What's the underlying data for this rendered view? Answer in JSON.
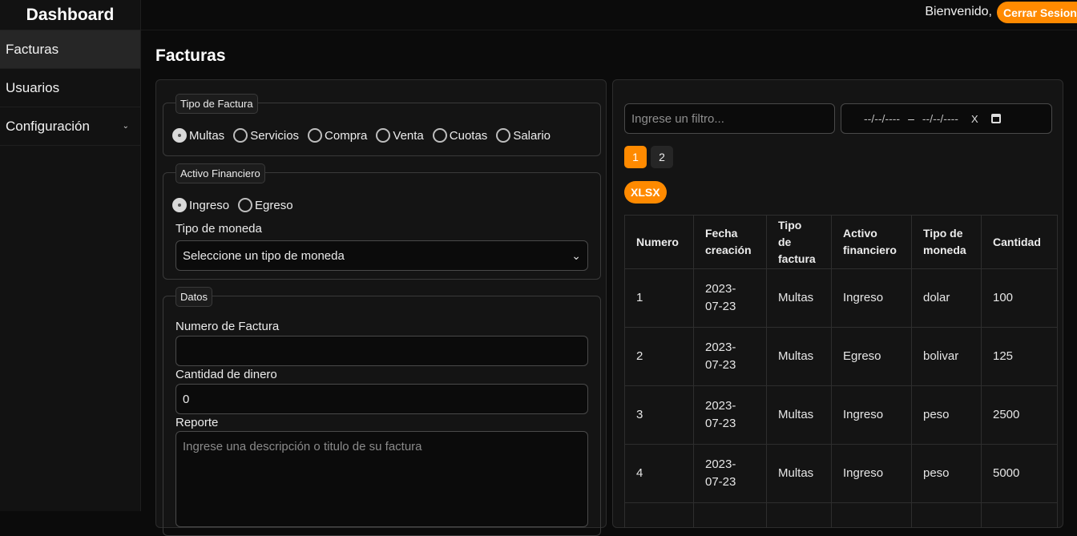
{
  "brand": "Dashboard",
  "sidebar": {
    "items": [
      {
        "label": "Facturas"
      },
      {
        "label": "Usuarios"
      },
      {
        "label": "Configuración"
      }
    ],
    "caret": "⌄"
  },
  "header": {
    "welcome": "Bienvenido,",
    "logout": "Cerrar Sesion"
  },
  "page_title": "Facturas",
  "form": {
    "tipo_factura": {
      "legend": "Tipo de Factura",
      "options": [
        "Multas",
        "Servicios",
        "Compra",
        "Venta",
        "Cuotas",
        "Salario"
      ],
      "selected": "Multas"
    },
    "activo": {
      "legend": "Activo Financiero",
      "options": [
        "Ingreso",
        "Egreso"
      ],
      "selected": "Ingreso",
      "moneda_label": "Tipo de moneda",
      "moneda_value": "Seleccione un tipo de moneda"
    },
    "datos": {
      "legend": "Datos",
      "numero_label": "Numero de Factura",
      "numero_value": "",
      "cantidad_label": "Cantidad de dinero",
      "cantidad_value": "0",
      "reporte_label": "Reporte",
      "reporte_placeholder": "Ingrese una descripción o titulo de su factura"
    }
  },
  "table_panel": {
    "filter_placeholder": "Ingrese un filtro...",
    "date_from": "--/--/----",
    "date_sep": "–",
    "date_to": "--/--/----",
    "date_clear": "X",
    "pages": [
      "1",
      "2"
    ],
    "active_page": "1",
    "export_label": "XLSX",
    "headers": [
      [
        "Numero"
      ],
      [
        "Fecha",
        "creación"
      ],
      [
        "Tipo",
        "de",
        "factura"
      ],
      [
        "Activo",
        "financiero"
      ],
      [
        "Tipo de",
        "moneda"
      ],
      [
        "Cantidad"
      ]
    ],
    "rows": [
      [
        [
          "1"
        ],
        [
          "2023-",
          "07-23"
        ],
        [
          "Multas"
        ],
        [
          "Ingreso"
        ],
        [
          "dolar"
        ],
        [
          "100"
        ]
      ],
      [
        [
          "2"
        ],
        [
          "2023-",
          "07-23"
        ],
        [
          "Multas"
        ],
        [
          "Egreso"
        ],
        [
          "bolivar"
        ],
        [
          "125"
        ]
      ],
      [
        [
          "3"
        ],
        [
          "2023-",
          "07-23"
        ],
        [
          "Multas"
        ],
        [
          "Ingreso"
        ],
        [
          "peso"
        ],
        [
          "2500"
        ]
      ],
      [
        [
          "4"
        ],
        [
          "2023-",
          "07-23"
        ],
        [
          "Multas"
        ],
        [
          "Ingreso"
        ],
        [
          "peso"
        ],
        [
          "5000"
        ]
      ]
    ]
  },
  "colors": {
    "accent": "#ff8a00",
    "background": "#0b0b0b",
    "panel": "#141414"
  }
}
